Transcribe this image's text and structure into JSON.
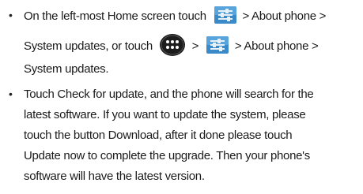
{
  "steps": [
    {
      "bullet": "•",
      "line1": {
        "text_before_icon": "On the left-most Home screen touch",
        "icon": "settings-sliders-icon",
        "text_after_icon": "> About phone >"
      },
      "line2": {
        "text_before_icon1": "System updates, or touch",
        "icon1": "apps-drawer-icon",
        "text_between": ">",
        "icon2": "settings-sliders-icon",
        "text_after_icon2": "> About phone >"
      },
      "line3": {
        "text": "System updates."
      }
    },
    {
      "bullet": "•",
      "lines": [
        "Touch Check for update, and the phone will search for the",
        "latest software. If you want to update the system, please",
        "touch the button Download, after it done please touch",
        "Update now to complete the upgrade. Then your phone's",
        "software will have the latest version."
      ]
    }
  ],
  "colors": {
    "text": "#1a1a1a",
    "settings_icon_bg": "#3a89c9",
    "settings_icon_sliders": "#e8f0f8",
    "apps_icon_bg": "#222222",
    "apps_icon_dots": "#ffffff"
  }
}
